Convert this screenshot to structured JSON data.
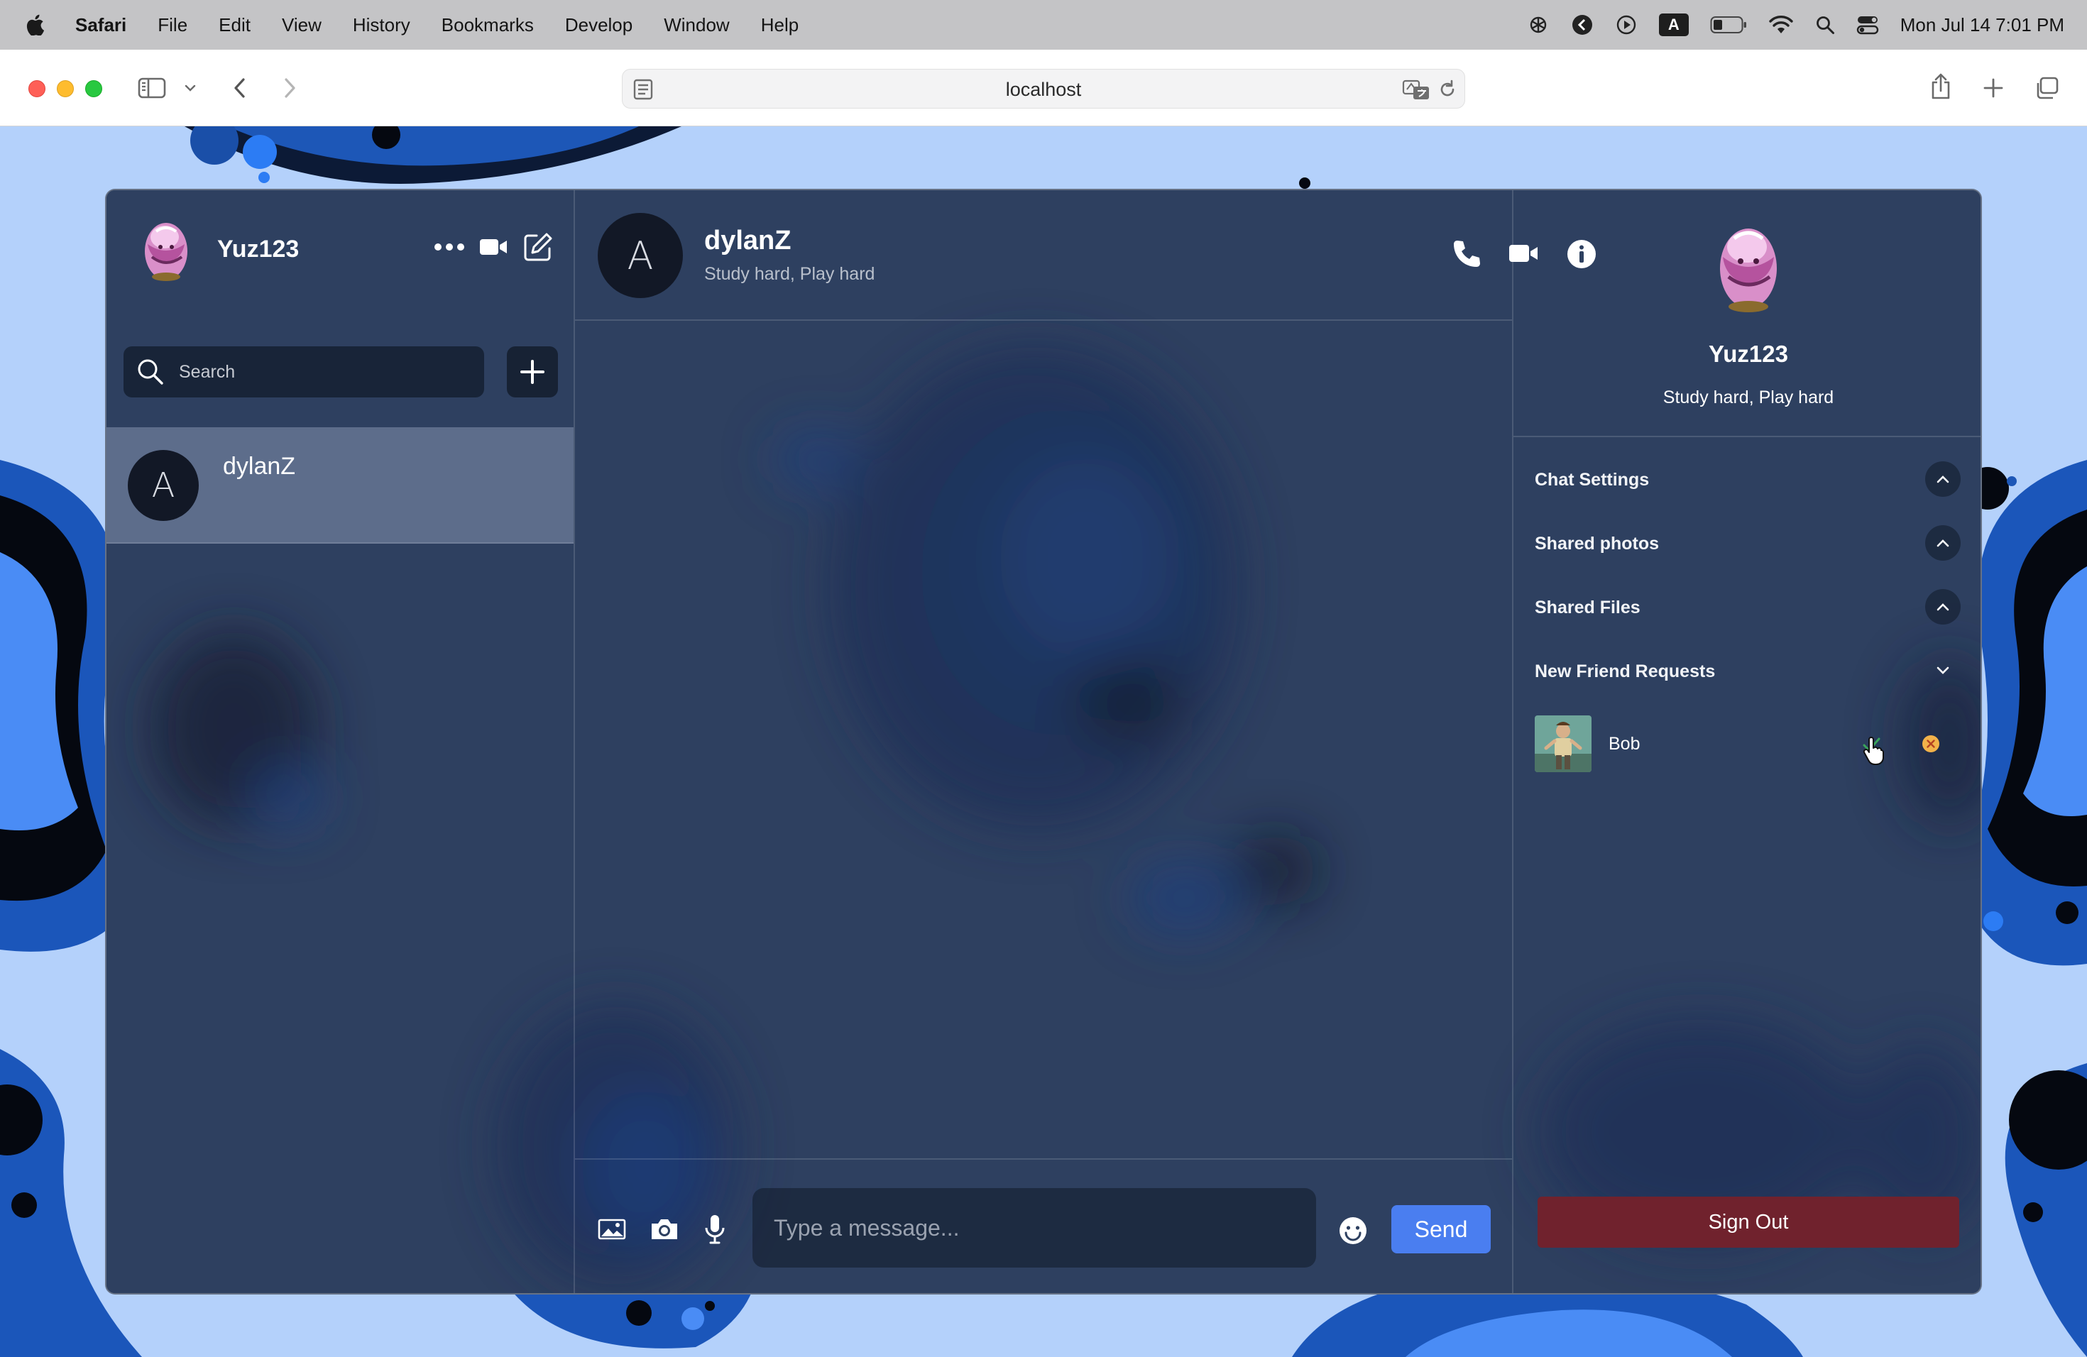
{
  "menubar": {
    "app_name": "Safari",
    "menus": [
      "File",
      "Edit",
      "View",
      "History",
      "Bookmarks",
      "Develop",
      "Window",
      "Help"
    ],
    "datetime": "Mon Jul 14  7:01 PM",
    "input_source": "A"
  },
  "browser": {
    "url": "localhost"
  },
  "sidebar": {
    "username": "Yuz123",
    "search_placeholder": "Search",
    "contacts": [
      {
        "initial": "A",
        "name": "dylanZ"
      }
    ]
  },
  "chat": {
    "contact_initial": "A",
    "contact_name": "dylanZ",
    "contact_status": "Study hard, Play hard",
    "message_placeholder": "Type a message...",
    "send_label": "Send"
  },
  "details": {
    "username": "Yuz123",
    "status": "Study hard, Play hard",
    "sections": [
      {
        "title": "Chat Settings",
        "state": "collapsed"
      },
      {
        "title": "Shared photos",
        "state": "collapsed"
      },
      {
        "title": "Shared Files",
        "state": "collapsed"
      },
      {
        "title": "New Friend Requests",
        "state": "expanded"
      }
    ],
    "friend_requests": [
      {
        "name": "Bob"
      }
    ],
    "signout_label": "Sign Out"
  },
  "colors": {
    "send_button": "#4a7ef0",
    "signout_button": "#70222d",
    "panel": "#2b3c58",
    "page_background": "#b4d1fb"
  }
}
